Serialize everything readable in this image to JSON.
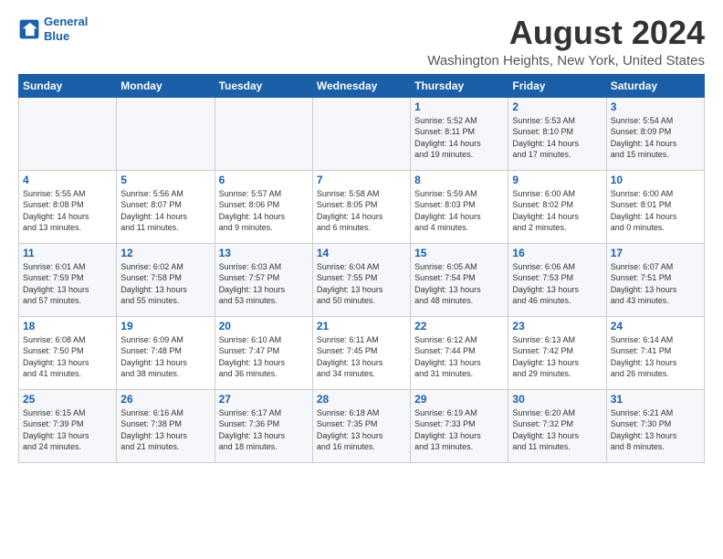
{
  "logo": {
    "line1": "General",
    "line2": "Blue"
  },
  "title": "August 2024",
  "subtitle": "Washington Heights, New York, United States",
  "days_of_week": [
    "Sunday",
    "Monday",
    "Tuesday",
    "Wednesday",
    "Thursday",
    "Friday",
    "Saturday"
  ],
  "weeks": [
    [
      {
        "day": "",
        "info": ""
      },
      {
        "day": "",
        "info": ""
      },
      {
        "day": "",
        "info": ""
      },
      {
        "day": "",
        "info": ""
      },
      {
        "day": "1",
        "info": "Sunrise: 5:52 AM\nSunset: 8:11 PM\nDaylight: 14 hours\nand 19 minutes."
      },
      {
        "day": "2",
        "info": "Sunrise: 5:53 AM\nSunset: 8:10 PM\nDaylight: 14 hours\nand 17 minutes."
      },
      {
        "day": "3",
        "info": "Sunrise: 5:54 AM\nSunset: 8:09 PM\nDaylight: 14 hours\nand 15 minutes."
      }
    ],
    [
      {
        "day": "4",
        "info": "Sunrise: 5:55 AM\nSunset: 8:08 PM\nDaylight: 14 hours\nand 13 minutes."
      },
      {
        "day": "5",
        "info": "Sunrise: 5:56 AM\nSunset: 8:07 PM\nDaylight: 14 hours\nand 11 minutes."
      },
      {
        "day": "6",
        "info": "Sunrise: 5:57 AM\nSunset: 8:06 PM\nDaylight: 14 hours\nand 9 minutes."
      },
      {
        "day": "7",
        "info": "Sunrise: 5:58 AM\nSunset: 8:05 PM\nDaylight: 14 hours\nand 6 minutes."
      },
      {
        "day": "8",
        "info": "Sunrise: 5:59 AM\nSunset: 8:03 PM\nDaylight: 14 hours\nand 4 minutes."
      },
      {
        "day": "9",
        "info": "Sunrise: 6:00 AM\nSunset: 8:02 PM\nDaylight: 14 hours\nand 2 minutes."
      },
      {
        "day": "10",
        "info": "Sunrise: 6:00 AM\nSunset: 8:01 PM\nDaylight: 14 hours\nand 0 minutes."
      }
    ],
    [
      {
        "day": "11",
        "info": "Sunrise: 6:01 AM\nSunset: 7:59 PM\nDaylight: 13 hours\nand 57 minutes."
      },
      {
        "day": "12",
        "info": "Sunrise: 6:02 AM\nSunset: 7:58 PM\nDaylight: 13 hours\nand 55 minutes."
      },
      {
        "day": "13",
        "info": "Sunrise: 6:03 AM\nSunset: 7:57 PM\nDaylight: 13 hours\nand 53 minutes."
      },
      {
        "day": "14",
        "info": "Sunrise: 6:04 AM\nSunset: 7:55 PM\nDaylight: 13 hours\nand 50 minutes."
      },
      {
        "day": "15",
        "info": "Sunrise: 6:05 AM\nSunset: 7:54 PM\nDaylight: 13 hours\nand 48 minutes."
      },
      {
        "day": "16",
        "info": "Sunrise: 6:06 AM\nSunset: 7:53 PM\nDaylight: 13 hours\nand 46 minutes."
      },
      {
        "day": "17",
        "info": "Sunrise: 6:07 AM\nSunset: 7:51 PM\nDaylight: 13 hours\nand 43 minutes."
      }
    ],
    [
      {
        "day": "18",
        "info": "Sunrise: 6:08 AM\nSunset: 7:50 PM\nDaylight: 13 hours\nand 41 minutes."
      },
      {
        "day": "19",
        "info": "Sunrise: 6:09 AM\nSunset: 7:48 PM\nDaylight: 13 hours\nand 38 minutes."
      },
      {
        "day": "20",
        "info": "Sunrise: 6:10 AM\nSunset: 7:47 PM\nDaylight: 13 hours\nand 36 minutes."
      },
      {
        "day": "21",
        "info": "Sunrise: 6:11 AM\nSunset: 7:45 PM\nDaylight: 13 hours\nand 34 minutes."
      },
      {
        "day": "22",
        "info": "Sunrise: 6:12 AM\nSunset: 7:44 PM\nDaylight: 13 hours\nand 31 minutes."
      },
      {
        "day": "23",
        "info": "Sunrise: 6:13 AM\nSunset: 7:42 PM\nDaylight: 13 hours\nand 29 minutes."
      },
      {
        "day": "24",
        "info": "Sunrise: 6:14 AM\nSunset: 7:41 PM\nDaylight: 13 hours\nand 26 minutes."
      }
    ],
    [
      {
        "day": "25",
        "info": "Sunrise: 6:15 AM\nSunset: 7:39 PM\nDaylight: 13 hours\nand 24 minutes."
      },
      {
        "day": "26",
        "info": "Sunrise: 6:16 AM\nSunset: 7:38 PM\nDaylight: 13 hours\nand 21 minutes."
      },
      {
        "day": "27",
        "info": "Sunrise: 6:17 AM\nSunset: 7:36 PM\nDaylight: 13 hours\nand 18 minutes."
      },
      {
        "day": "28",
        "info": "Sunrise: 6:18 AM\nSunset: 7:35 PM\nDaylight: 13 hours\nand 16 minutes."
      },
      {
        "day": "29",
        "info": "Sunrise: 6:19 AM\nSunset: 7:33 PM\nDaylight: 13 hours\nand 13 minutes."
      },
      {
        "day": "30",
        "info": "Sunrise: 6:20 AM\nSunset: 7:32 PM\nDaylight: 13 hours\nand 11 minutes."
      },
      {
        "day": "31",
        "info": "Sunrise: 6:21 AM\nSunset: 7:30 PM\nDaylight: 13 hours\nand 8 minutes."
      }
    ]
  ]
}
